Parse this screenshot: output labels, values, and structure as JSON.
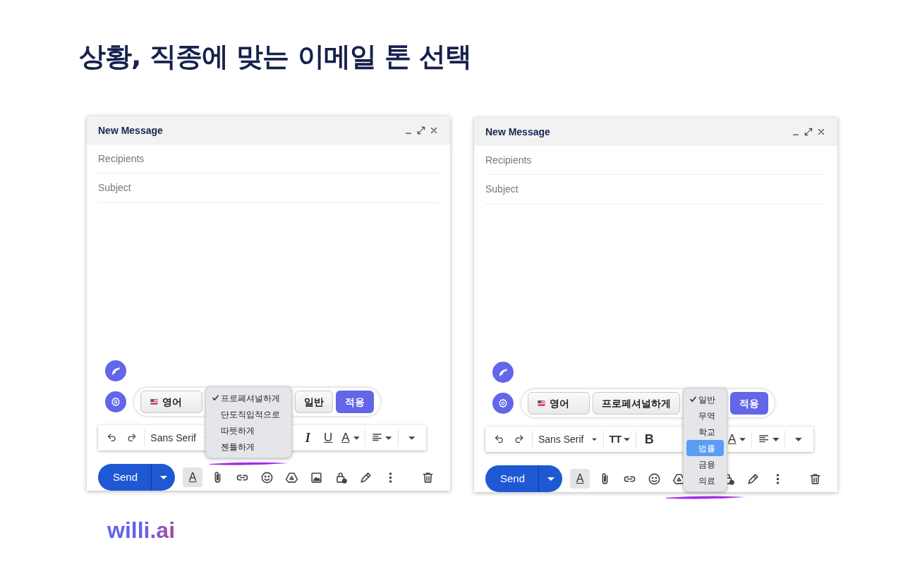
{
  "heading": "상황, 직종에 맞는 이메일 톤 선택",
  "composers": [
    {
      "title": "New Message",
      "recipients_placeholder": "Recipients",
      "subject_placeholder": "Subject",
      "options": [
        {
          "kind": "language",
          "label": "영어"
        },
        {
          "kind": "menu",
          "items": [
            {
              "label": "프로페셔널하게",
              "checked": true,
              "highlighted": false
            },
            {
              "label": "단도직입적으로",
              "checked": false,
              "highlighted": false
            },
            {
              "label": "따뜻하게",
              "checked": false,
              "highlighted": false
            },
            {
              "label": "젠틀하게",
              "checked": false,
              "highlighted": false
            }
          ]
        },
        {
          "kind": "chip",
          "label": "일반"
        },
        {
          "kind": "apply",
          "label": "적용"
        }
      ],
      "format_tools": [
        {
          "kind": "undo"
        },
        {
          "kind": "redo"
        },
        {
          "kind": "divider"
        },
        {
          "kind": "font",
          "label": "Sans Serif"
        },
        {
          "kind": "gap"
        },
        {
          "kind": "gap"
        },
        {
          "kind": "gap"
        },
        {
          "kind": "gap"
        },
        {
          "kind": "italic",
          "label": "I"
        },
        {
          "kind": "underline",
          "label": "U"
        },
        {
          "kind": "color",
          "label": "A"
        },
        {
          "kind": "divider"
        },
        {
          "kind": "align"
        },
        {
          "kind": "divider"
        },
        {
          "kind": "more"
        }
      ],
      "send_label": "Send",
      "actions": [
        {
          "kind": "format",
          "label": "A"
        },
        {
          "kind": "attach"
        },
        {
          "kind": "link"
        },
        {
          "kind": "emoji"
        },
        {
          "kind": "drive"
        },
        {
          "kind": "image"
        },
        {
          "kind": "lock"
        },
        {
          "kind": "pen"
        },
        {
          "kind": "more"
        },
        {
          "kind": "trash"
        }
      ]
    },
    {
      "title": "New Message",
      "recipients_placeholder": "Recipients",
      "subject_placeholder": "Subject",
      "options": [
        {
          "kind": "language",
          "label": "영어"
        },
        {
          "kind": "chip",
          "label": "프로페셔널하게"
        },
        {
          "kind": "menu",
          "items": [
            {
              "label": "일반",
              "checked": true,
              "highlighted": false
            },
            {
              "label": "무역",
              "checked": false,
              "highlighted": false
            },
            {
              "label": "학교",
              "checked": false,
              "highlighted": false
            },
            {
              "label": "법률",
              "checked": false,
              "highlighted": true
            },
            {
              "label": "금융",
              "checked": false,
              "highlighted": false
            },
            {
              "label": "의료",
              "checked": false,
              "highlighted": false
            }
          ]
        },
        {
          "kind": "apply",
          "label": "적용"
        }
      ],
      "format_tools": [
        {
          "kind": "undo"
        },
        {
          "kind": "redo"
        },
        {
          "kind": "divider"
        },
        {
          "kind": "font",
          "label": "Sans Serif"
        },
        {
          "kind": "divider"
        },
        {
          "kind": "size",
          "label": "TT"
        },
        {
          "kind": "divider"
        },
        {
          "kind": "bold",
          "label": "B"
        },
        {
          "kind": "gap"
        },
        {
          "kind": "gap"
        },
        {
          "kind": "gap"
        },
        {
          "kind": "color",
          "label": "A"
        },
        {
          "kind": "divider"
        },
        {
          "kind": "align"
        },
        {
          "kind": "divider"
        },
        {
          "kind": "more"
        }
      ],
      "send_label": "Send",
      "actions": [
        {
          "kind": "format",
          "label": "A"
        },
        {
          "kind": "attach"
        },
        {
          "kind": "link"
        },
        {
          "kind": "emoji"
        },
        {
          "kind": "drive"
        },
        {
          "kind": "gap"
        },
        {
          "kind": "lock"
        },
        {
          "kind": "pen"
        },
        {
          "kind": "more"
        },
        {
          "kind": "trash"
        }
      ]
    }
  ],
  "logo": "willi.ai"
}
